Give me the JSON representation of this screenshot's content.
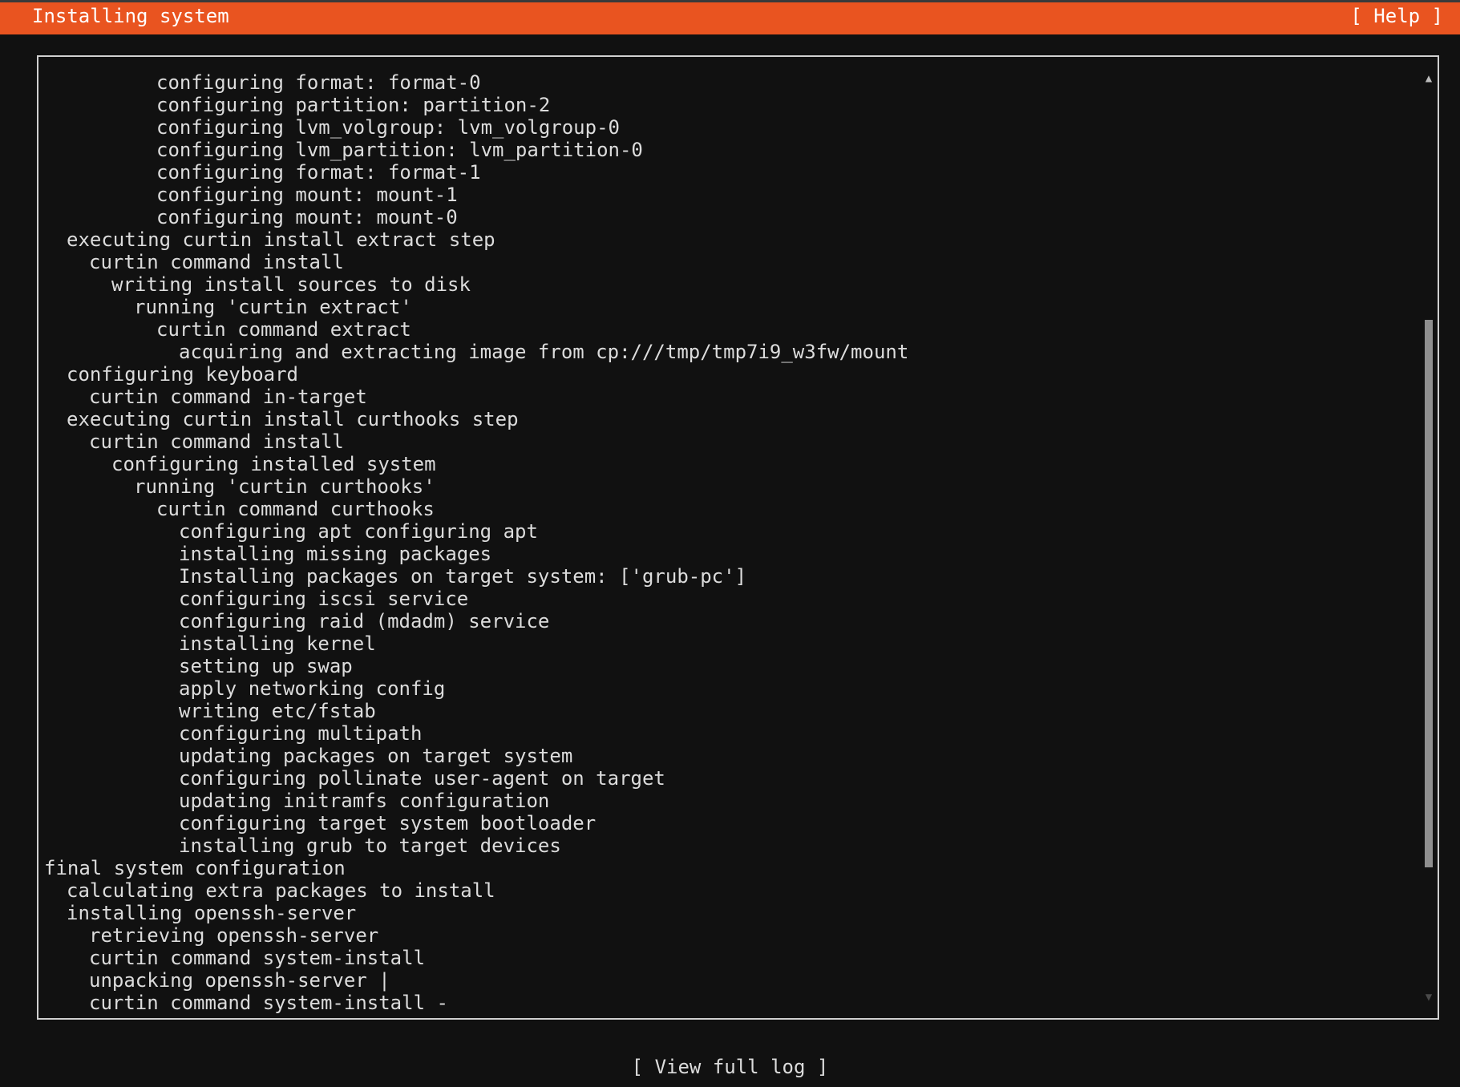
{
  "header": {
    "title": "Installing system",
    "help_label": "[ Help ]"
  },
  "log": {
    "lines": [
      {
        "text": "configuring format: format-0",
        "indent": 5
      },
      {
        "text": "configuring partition: partition-2",
        "indent": 5
      },
      {
        "text": "configuring lvm_volgroup: lvm_volgroup-0",
        "indent": 5
      },
      {
        "text": "configuring lvm_partition: lvm_partition-0",
        "indent": 5
      },
      {
        "text": "configuring format: format-1",
        "indent": 5
      },
      {
        "text": "configuring mount: mount-1",
        "indent": 5
      },
      {
        "text": "configuring mount: mount-0",
        "indent": 5
      },
      {
        "text": "executing curtin install extract step",
        "indent": 1
      },
      {
        "text": "curtin command install",
        "indent": 2
      },
      {
        "text": "writing install sources to disk",
        "indent": 3
      },
      {
        "text": "running 'curtin extract'",
        "indent": 4
      },
      {
        "text": "curtin command extract",
        "indent": 5
      },
      {
        "text": "acquiring and extracting image from cp:///tmp/tmp7i9_w3fw/mount",
        "indent": 6
      },
      {
        "text": "configuring keyboard",
        "indent": 1
      },
      {
        "text": "curtin command in-target",
        "indent": 2
      },
      {
        "text": "executing curtin install curthooks step",
        "indent": 1
      },
      {
        "text": "curtin command install",
        "indent": 2
      },
      {
        "text": "configuring installed system",
        "indent": 3
      },
      {
        "text": "running 'curtin curthooks'",
        "indent": 4
      },
      {
        "text": "curtin command curthooks",
        "indent": 5
      },
      {
        "text": "configuring apt configuring apt",
        "indent": 6
      },
      {
        "text": "installing missing packages",
        "indent": 6
      },
      {
        "text": "Installing packages on target system: ['grub-pc']",
        "indent": 6
      },
      {
        "text": "configuring iscsi service",
        "indent": 6
      },
      {
        "text": "configuring raid (mdadm) service",
        "indent": 6
      },
      {
        "text": "installing kernel",
        "indent": 6
      },
      {
        "text": "setting up swap",
        "indent": 6
      },
      {
        "text": "apply networking config",
        "indent": 6
      },
      {
        "text": "writing etc/fstab",
        "indent": 6
      },
      {
        "text": "configuring multipath",
        "indent": 6
      },
      {
        "text": "updating packages on target system",
        "indent": 6
      },
      {
        "text": "configuring pollinate user-agent on target",
        "indent": 6
      },
      {
        "text": "updating initramfs configuration",
        "indent": 6
      },
      {
        "text": "configuring target system bootloader",
        "indent": 6
      },
      {
        "text": "installing grub to target devices",
        "indent": 6
      },
      {
        "text": "final system configuration",
        "indent": 0
      },
      {
        "text": "calculating extra packages to install",
        "indent": 1
      },
      {
        "text": "installing openssh-server",
        "indent": 1
      },
      {
        "text": "retrieving openssh-server",
        "indent": 2
      },
      {
        "text": "curtin command system-install",
        "indent": 2
      },
      {
        "text": "unpacking openssh-server |",
        "indent": 2
      },
      {
        "text": "curtin command system-install -",
        "indent": 2
      }
    ],
    "scroll_position": 0.66,
    "scroll_visible_fraction": 0.61
  },
  "footer": {
    "view_log_label": "[ View full log ]"
  },
  "colors": {
    "header_bg": "#e95420",
    "background": "#111111",
    "text": "#dcdcdc"
  }
}
